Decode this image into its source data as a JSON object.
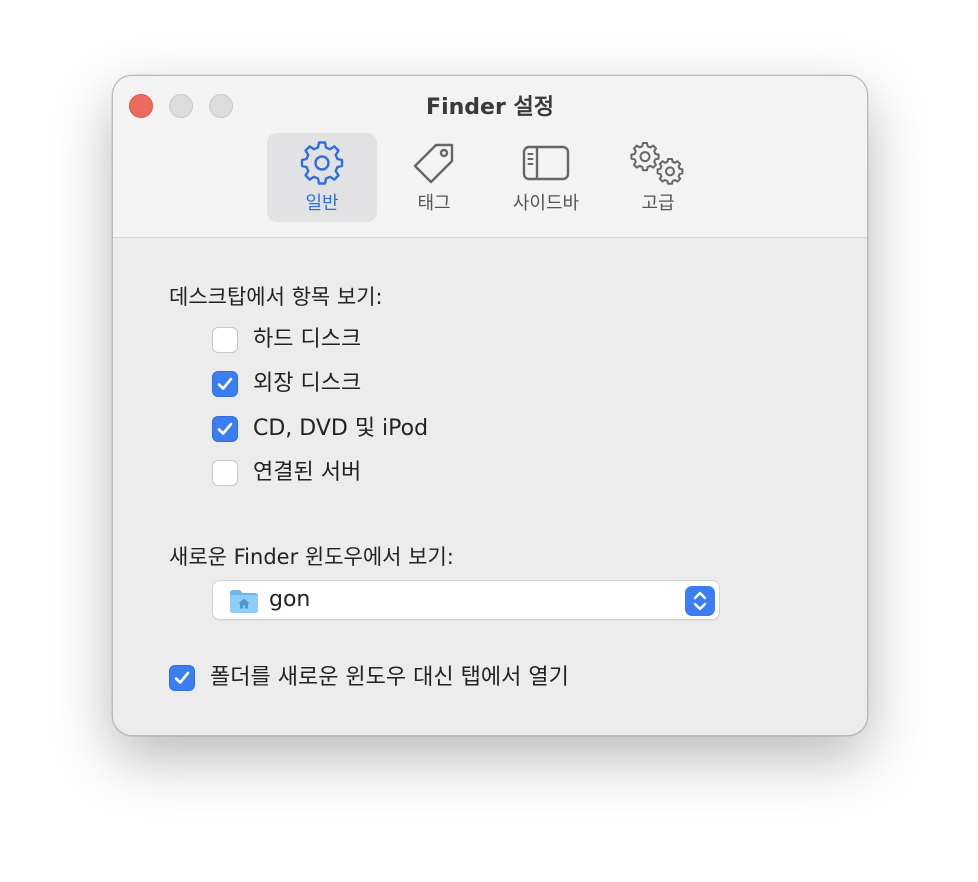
{
  "window": {
    "title": "Finder 설정"
  },
  "tabs": [
    {
      "label": "일반",
      "icon": "gear-icon",
      "selected": true
    },
    {
      "label": "태그",
      "icon": "tag-icon",
      "selected": false
    },
    {
      "label": "사이드바",
      "icon": "sidebar-icon",
      "selected": false
    },
    {
      "label": "고급",
      "icon": "gears-icon",
      "selected": false
    }
  ],
  "desktop_section": {
    "label": "데스크탑에서 항목 보기:",
    "options": [
      {
        "label": "하드 디스크",
        "checked": false
      },
      {
        "label": "외장 디스크",
        "checked": true
      },
      {
        "label": "CD, DVD 및 iPod",
        "checked": true
      },
      {
        "label": "연결된 서버",
        "checked": false
      }
    ]
  },
  "new_window_section": {
    "label": "새로운 Finder 윈도우에서 보기:",
    "selected_value": "gon",
    "selected_icon": "home-folder-icon"
  },
  "open_folders_in_tabs": {
    "label": "폴더를 새로운 윈도우 대신 탭에서 열기",
    "checked": true
  },
  "colors": {
    "accent": "#3a7ef1",
    "close_button": "#ed6a5e",
    "window_background": "#ececec"
  }
}
